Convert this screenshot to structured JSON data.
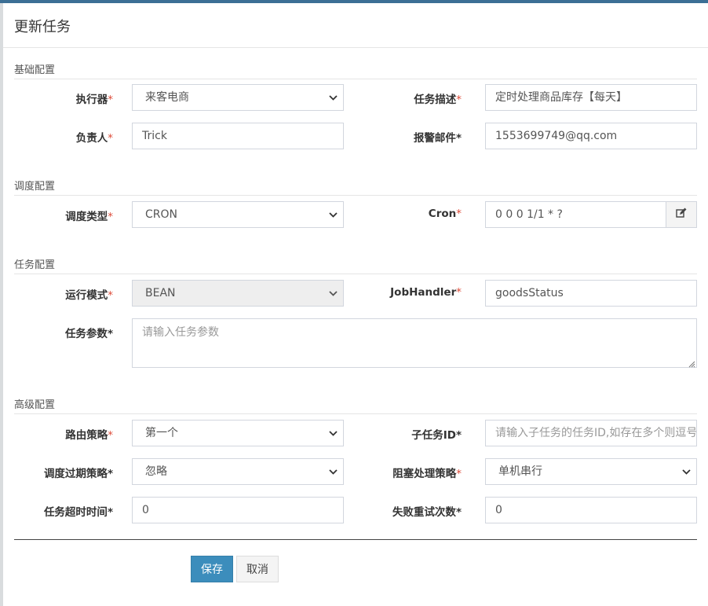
{
  "modal": {
    "title": "更新任务"
  },
  "sections": {
    "basic": "基础配置",
    "schedule": "调度配置",
    "task": "任务配置",
    "advanced": "高级配置"
  },
  "fields": {
    "executor": {
      "label": "执行器",
      "value": "来客电商"
    },
    "job_desc": {
      "label": "任务描述",
      "value": "定时处理商品库存【每天】"
    },
    "author": {
      "label": "负责人",
      "value": "Trick"
    },
    "alarm_email": {
      "label": "报警邮件",
      "value": "1553699749@qq.com"
    },
    "schedule_type": {
      "label": "调度类型",
      "value": "CRON"
    },
    "cron": {
      "label": "Cron",
      "value": "0 0 0 1/1 * ?"
    },
    "glue_type": {
      "label": "运行模式",
      "value": "BEAN"
    },
    "job_handler": {
      "label": "JobHandler",
      "value": "goodsStatus"
    },
    "job_param": {
      "label": "任务参数",
      "placeholder": "请输入任务参数"
    },
    "route_strategy": {
      "label": "路由策略",
      "value": "第一个"
    },
    "child_job_id": {
      "label": "子任务ID",
      "placeholder": "请输入子任务的任务ID,如存在多个则逗号分隔"
    },
    "misfire_strategy": {
      "label": "调度过期策略",
      "value": "忽略"
    },
    "block_strategy": {
      "label": "阻塞处理策略",
      "value": "单机串行"
    },
    "timeout": {
      "label": "任务超时时间",
      "value": "0"
    },
    "fail_retry": {
      "label": "失败重试次数",
      "value": "0"
    }
  },
  "buttons": {
    "save": "保存",
    "cancel": "取消"
  },
  "required_mark": "*",
  "colors": {
    "primary": "#3c8dbc",
    "required": "#dd4b39",
    "header_bar": "#3c6f95"
  }
}
